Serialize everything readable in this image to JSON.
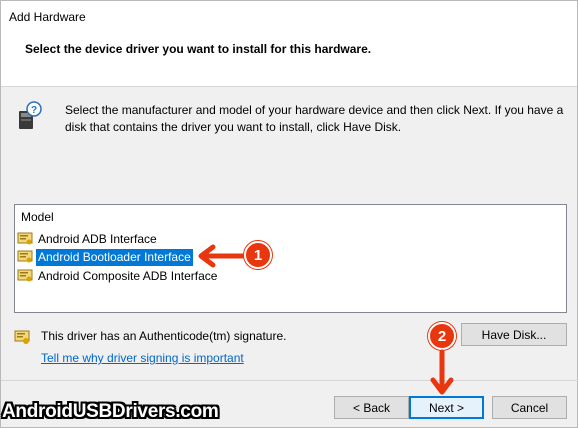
{
  "window": {
    "title": "Add Hardware",
    "heading": "Select the device driver you want to install for this hardware."
  },
  "intro": {
    "text": "Select the manufacturer and model of your hardware device and then click Next. If you have a disk that contains the driver you want to install, click Have Disk."
  },
  "model_list": {
    "header": "Model",
    "items": [
      {
        "label": "Android ADB Interface",
        "selected": false
      },
      {
        "label": "Android Bootloader Interface",
        "selected": true
      },
      {
        "label": "Android Composite ADB Interface",
        "selected": false
      }
    ]
  },
  "signature": {
    "text": "This driver has an Authenticode(tm) signature.",
    "link": "Tell me why driver signing is important"
  },
  "buttons": {
    "have_disk": "Have Disk...",
    "back": "< Back",
    "next": "Next >",
    "cancel": "Cancel"
  },
  "annotations": {
    "step_1": "1",
    "step_2": "2",
    "color": "#e8360e"
  },
  "watermark": "AndroidUSBDrivers.com",
  "colors": {
    "selection": "#0078d7",
    "link": "#0066cc",
    "dialog_bg": "#f0f0f0"
  }
}
